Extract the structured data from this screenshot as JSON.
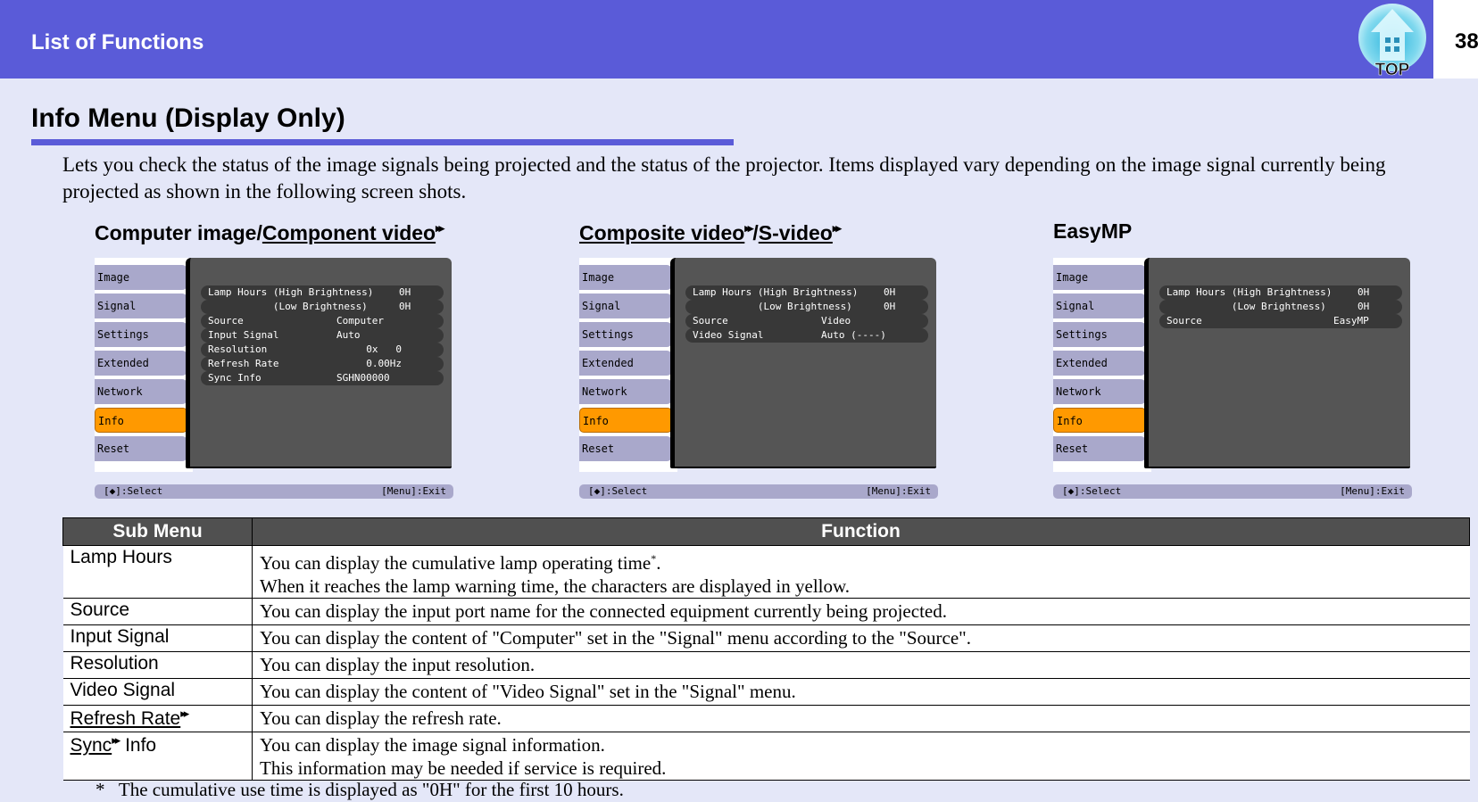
{
  "header": {
    "title": "List of Functions",
    "page_number": "38",
    "top_button_label": "TOP",
    "top_button_icon": "home-arrow-up-icon",
    "colors": {
      "header_bg": "#5a5bd8",
      "page_bg": "#e4e7f8",
      "active_tab": "#ff9900"
    }
  },
  "section": {
    "title": "Info Menu (Display Only)",
    "intro": "Lets you check the status of the image signals being projected and the status of the projector. Items displayed vary depending on the image signal currently being projected as shown in the following screen shots."
  },
  "screenshots": [
    {
      "title_plain": "Computer image/",
      "title_link": "Component video",
      "title_link2": "",
      "menu_tabs": [
        "Image",
        "Signal",
        "Settings",
        "Extended",
        "Network",
        "Info",
        "Reset"
      ],
      "active_tab": "Info",
      "rows": [
        {
          "label": "Lamp Hours (High Brightness)",
          "value": "0H"
        },
        {
          "label": "           (Low Brightness)",
          "value": "0H"
        },
        {
          "label": "Source",
          "value": "Computer"
        },
        {
          "label": "Input Signal",
          "value": "Auto"
        },
        {
          "label": "Resolution",
          "value": "  0x   0"
        },
        {
          "label": "Refresh Rate",
          "value": "  0.00Hz"
        },
        {
          "label": "Sync Info",
          "value": "SGHN00000"
        }
      ],
      "footer_left": "[◆]:Select",
      "footer_right": "[Menu]:Exit"
    },
    {
      "title_plain": "",
      "title_link": "Composite video",
      "title_link2": "S-video",
      "menu_tabs": [
        "Image",
        "Signal",
        "Settings",
        "Extended",
        "Network",
        "Info",
        "Reset"
      ],
      "active_tab": "Info",
      "rows": [
        {
          "label": "Lamp Hours (High Brightness)",
          "value": "0H"
        },
        {
          "label": "           (Low Brightness)",
          "value": "0H"
        },
        {
          "label": "Source",
          "value": "Video"
        },
        {
          "label": "Video Signal",
          "value": "Auto (----)"
        }
      ],
      "footer_left": "[◆]:Select",
      "footer_right": "[Menu]:Exit"
    },
    {
      "title_plain": "EasyMP",
      "title_link": "",
      "title_link2": "",
      "menu_tabs": [
        "Image",
        "Signal",
        "Settings",
        "Extended",
        "Network",
        "Info",
        "Reset"
      ],
      "active_tab": "Info",
      "rows": [
        {
          "label": "Lamp Hours (High Brightness)",
          "value": "0H"
        },
        {
          "label": "           (Low Brightness)",
          "value": "0H"
        },
        {
          "label": "Source",
          "value": "EasyMP"
        }
      ],
      "footer_left": "[◆]:Select",
      "footer_right": "[Menu]:Exit"
    }
  ],
  "table": {
    "headers": [
      "Sub Menu",
      "Function"
    ],
    "rows": [
      {
        "sub": "Lamp Hours",
        "sub_link": "",
        "sub_suffix": "",
        "func": [
          "You can display the cumulative lamp operating time",
          "When it reaches the lamp warning time, the characters are displayed in yellow."
        ],
        "footnote_mark": "*"
      },
      {
        "sub": "Source",
        "sub_link": "",
        "sub_suffix": "",
        "func": [
          "You can display the input port name for the connected equipment currently being projected."
        ]
      },
      {
        "sub": "Input Signal",
        "sub_link": "",
        "sub_suffix": "",
        "func": [
          "You can display the content of \"Computer\" set in the \"Signal\" menu according to the \"Source\"."
        ]
      },
      {
        "sub": "Resolution",
        "sub_link": "",
        "sub_suffix": "",
        "func": [
          "You can display the input resolution."
        ]
      },
      {
        "sub": "Video Signal",
        "sub_link": "",
        "sub_suffix": "",
        "func": [
          "You can display the content of \"Video Signal\" set in the \"Signal\" menu."
        ]
      },
      {
        "sub": "",
        "sub_link": "Refresh Rate",
        "sub_suffix": "",
        "func": [
          "You can display the refresh rate."
        ]
      },
      {
        "sub": "",
        "sub_link": "Sync",
        "sub_suffix": " Info",
        "func": [
          "You can display the image signal information.",
          "This information may be needed if service is required."
        ]
      }
    ]
  },
  "footnote": {
    "mark": "*",
    "text": "The cumulative use time is displayed as \"0H\" for the first 10 hours."
  }
}
